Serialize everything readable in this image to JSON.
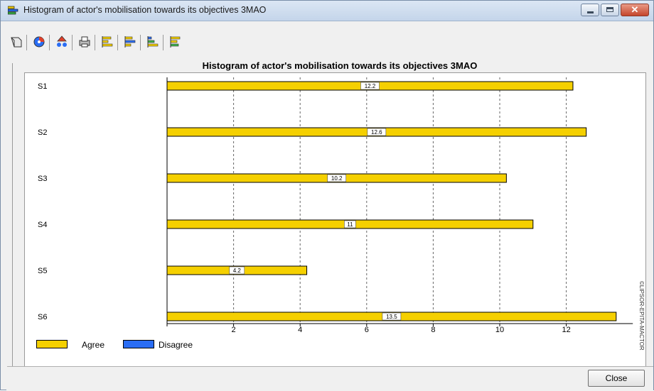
{
  "window": {
    "title": "Histogram of actor's mobilisation towards its objectives 3MAO",
    "close_label": "Close"
  },
  "toolbar": {
    "buttons": [
      "copy-icon",
      "color-palette-icon",
      "filter-icon",
      "print-icon",
      "bar-chart-icon",
      "bar-chart-alt-icon",
      "sorted-bar-chart-icon",
      "bar-chart-options-icon"
    ]
  },
  "colors": {
    "agree": "#f5d000",
    "disagree": "#2a6df4"
  },
  "copyright": "©LIPSOR-EPITA-MACTOR",
  "chart_data": {
    "type": "bar",
    "orientation": "horizontal",
    "title": "Histogram of actor's mobilisation towards its objectives 3MAO",
    "categories": [
      "S1",
      "S2",
      "S3",
      "S4",
      "S5",
      "S6"
    ],
    "series": [
      {
        "name": "Agree",
        "values": [
          12.2,
          12.6,
          10.2,
          11,
          4.2,
          13.5
        ]
      },
      {
        "name": "Disagree",
        "values": [
          0,
          0,
          0,
          0,
          0,
          0
        ]
      }
    ],
    "data_labels": [
      "12.2",
      "12.6",
      "10.2",
      "11",
      "4.2",
      "13.5"
    ],
    "xlim": [
      0,
      14
    ],
    "x_ticks": [
      2,
      4,
      6,
      8,
      10,
      12
    ],
    "grid": "vertical dashed",
    "legend_position": "bottom-left"
  }
}
